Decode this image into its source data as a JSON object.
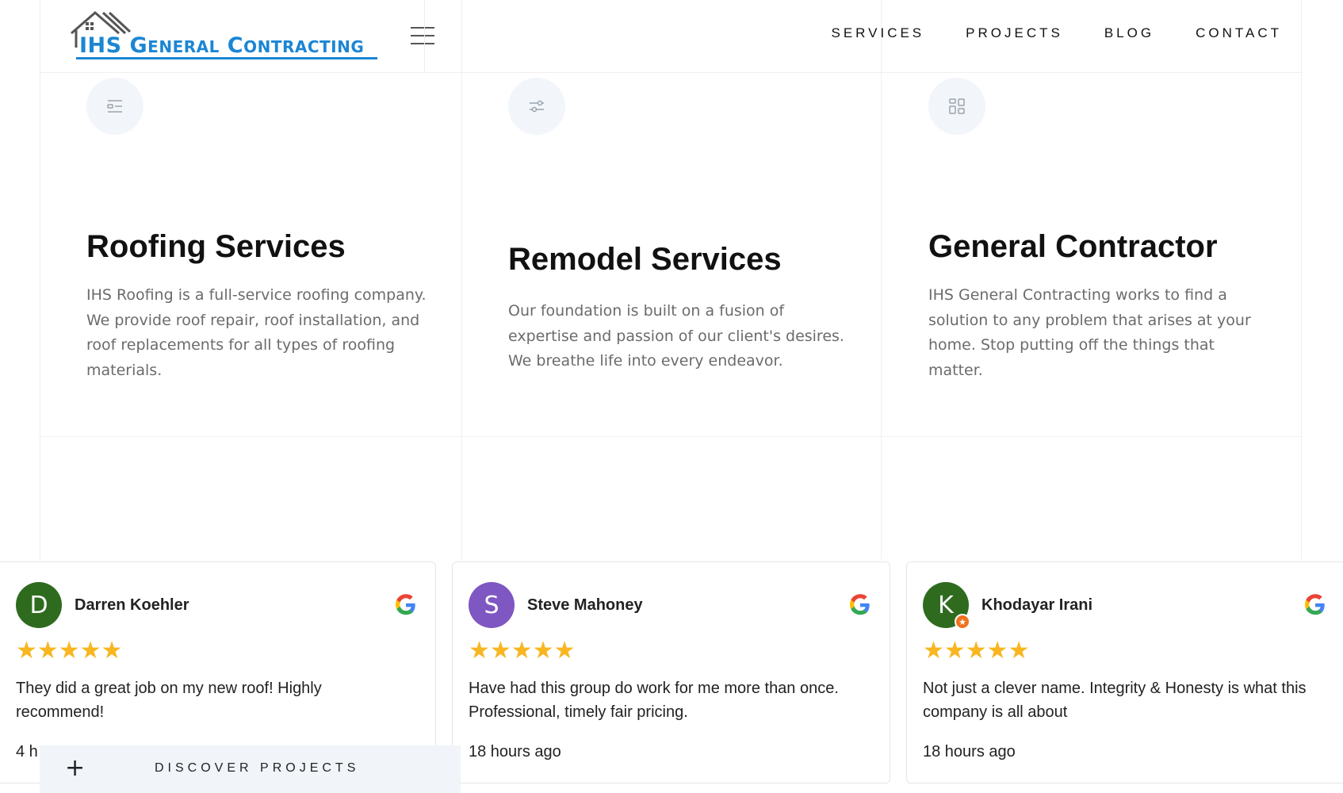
{
  "header": {
    "logo_text_first": "IHS ",
    "logo_text_g": "G",
    "logo_text_eneral": "ENERAL",
    "logo_text_c": " C",
    "logo_text_ontracting": "ONTRACTING",
    "nav": [
      "SERVICES",
      "PROJECTS",
      "BLOG",
      "CONTACT"
    ]
  },
  "services": [
    {
      "icon": "list-icon",
      "title": "Roofing Services",
      "body": "IHS Roofing is a full-service roofing company. We provide roof repair, roof installation, and roof replacements for all types of roofing materials."
    },
    {
      "icon": "sliders-icon",
      "title": "Remodel Services",
      "body": "Our foundation is built on a fusion of expertise and passion of our client's desires. We breathe life into every endeavor."
    },
    {
      "icon": "grid-icon",
      "title": "General Contractor",
      "body": "IHS General Contracting works to find a solution to any problem that arises at your home. Stop putting off the things that matter."
    }
  ],
  "reviews": [
    {
      "initial": "D",
      "avatar_color": "#2f6b1f",
      "name": "Darren Koehler",
      "stars": "★★★★★",
      "rating": 5,
      "text": "They did a great job on my new roof! Highly recommend!",
      "time": "4 h"
    },
    {
      "initial": "S",
      "avatar_color": "#7e57c2",
      "name": "Steve Mahoney",
      "stars": "★★★★★",
      "rating": 5,
      "text": "Have had this group do work for me more than once. Professional, timely fair pricing.",
      "time": "18 hours ago"
    },
    {
      "initial": "K",
      "avatar_color": "#2f6b1f",
      "name": "Khodayar Irani",
      "stars": "★★★★★",
      "rating": 5,
      "text": "Not just a clever name. Integrity & Honesty is what this company is all about",
      "time": "18 hours ago"
    }
  ],
  "discover": {
    "plus": "+",
    "label": "DISCOVER PROJECTS"
  },
  "colors": {
    "brand_blue": "#1b86d4",
    "star": "#f8b621",
    "muted_text": "#6b6b6b"
  }
}
